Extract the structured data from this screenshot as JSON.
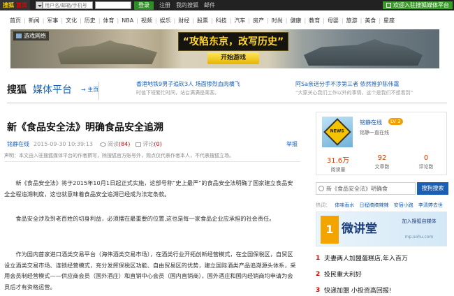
{
  "topbar": {
    "logo_text": "搜狐",
    "home_label": "首页",
    "username_placeholder": "用户名/邮箱/手机号",
    "password_placeholder": "",
    "login_label": "登录",
    "register_label": "注册",
    "my_sohu_label": "我的搜狐",
    "mail_label": "邮件",
    "welcome_label": "欢迎入驻搜狐媒体平台"
  },
  "nav": [
    "首页",
    "新闻",
    "军事",
    "文化",
    "历史",
    "体育",
    "NBA",
    "视频",
    "娱乐",
    "财经",
    "股票",
    "科技",
    "汽车",
    "房产",
    "时尚",
    "健康",
    "教育",
    "母婴",
    "旅游",
    "美食",
    "星座"
  ],
  "banner": {
    "tag": "游戏网络",
    "slogan": "“攻陷东京，改写历史”",
    "play_label": "开始游戏"
  },
  "brand": {
    "sohu": "搜狐",
    "media_platform": "媒体平台",
    "home_link": "→ 主页"
  },
  "header_news": [
    {
      "title": "香港地铁9男子追砍3人 场面惨烈血肉横飞",
      "sub": "时值下班繁忙时间，站台满满是乘客。"
    },
    {
      "title": "阿Sa亲送分手不涉第三者 依然推护陈伟霆",
      "sub": "“大家关心我们工作以外的事情，这个是我们不想看到”"
    }
  ],
  "article": {
    "title": "新《食品安全法》明确食品安全追溯",
    "author": "铭静在线",
    "datetime": "2015-09-30 10:39:13",
    "read_label": "阅读",
    "read_count": "(84)",
    "comment_label": "评论",
    "comment_count": "(0)",
    "report_label": "举报",
    "declaration": "声明：本文由入驻搜狐媒体平台的作者撰写，除搜狐官方账号外，观点仅代表作者本人，不代表搜狐立场。",
    "paragraphs": [
      "新《食品安全法》将于2015年10月1日起正式实施，这部号称“史上最严”的食品安全法明确了国家建立食品安全全程追溯制度，这也就意味着食品安全追溯已经成为法定条款。",
      "食品安全涉及到老百姓的切身利益，必须摆在最重要的位置,这也是每一家食品企业应承担的社会责任。",
      "作为国内首家进口酒类交易平台（海伟酒类交易市场），在酒类行业开拓创新经营模式，在全国保税区，自贸区设立酒类交易市场、连锁经营模式，充分发挥保税区功能、自由贸易区的优势，建立国际酒类产品追溯源头体系，采用会员制经营模式——供应商会员（国外酒庄）和直销中心会员（国内直销商），国外酒庄和国内经销商均申请为会员后才有资格运营。"
    ]
  },
  "profile": {
    "name": "铭静在线",
    "level": "LV 3",
    "desc": "铭静一直在线",
    "stats": [
      {
        "num": "31.6万",
        "label": "阅读量"
      },
      {
        "num": "92",
        "label": "文章数"
      },
      {
        "num": "0",
        "label": "评论数"
      }
    ]
  },
  "search": {
    "placeholder": "新《食品安全法》明确食",
    "button": "搜狗搜索"
  },
  "hot": {
    "label": "热词：",
    "keywords": [
      "体味香水",
      "日程搞搞辣辣",
      "安宿小跑",
      "李清婷去世"
    ]
  },
  "ad": {
    "badge": "1",
    "title": "微讲堂",
    "right_line1": "加入搜狐自媒体",
    "right_line2": "mp.sohu.com"
  },
  "rank": [
    {
      "n": "1",
      "text": "夫妻两人加盟蛋糕店,年入百万"
    },
    {
      "n": "2",
      "text": "投民重大利好"
    },
    {
      "n": "3",
      "text": "快递加盟 小投资高回报!"
    }
  ],
  "colors": {
    "accent": "#1a5fb4",
    "login_green": "#2e8f26",
    "highlight_red": "#d40000"
  }
}
